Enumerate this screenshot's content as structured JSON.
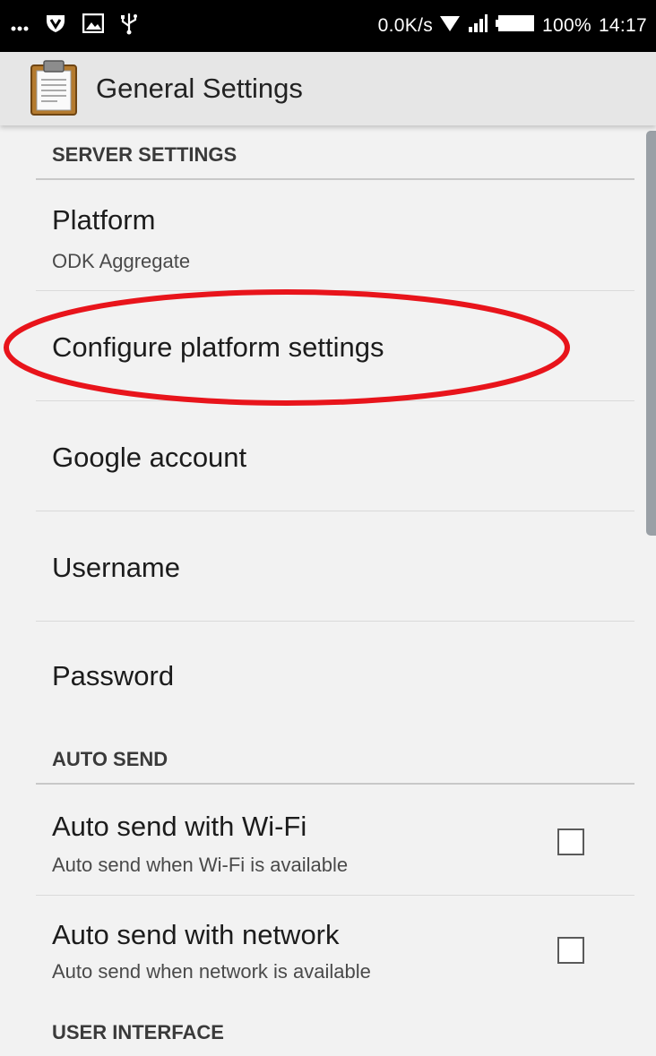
{
  "status_bar": {
    "left_icons": [
      "more-icon",
      "vpn-shield-icon",
      "image-icon",
      "usb-icon"
    ],
    "network_speed": "0.0K/s",
    "battery": "100%",
    "time": "14:17"
  },
  "app_bar": {
    "title": "General Settings",
    "icon": "clipboard-icon"
  },
  "sections": {
    "server": {
      "header": "SERVER SETTINGS",
      "platform": {
        "title": "Platform",
        "summary": "ODK Aggregate"
      },
      "configure": {
        "title": "Configure platform settings"
      },
      "google_account": {
        "title": "Google account"
      },
      "username": {
        "title": "Username"
      },
      "password": {
        "title": "Password"
      }
    },
    "auto_send": {
      "header": "AUTO SEND",
      "wifi": {
        "title": "Auto send with Wi-Fi",
        "summary": "Auto send when Wi-Fi is available",
        "checked": false
      },
      "network": {
        "title": "Auto send with network",
        "summary": "Auto send when network is available",
        "checked": false
      }
    },
    "user_interface": {
      "header": "USER INTERFACE"
    }
  },
  "colors": {
    "status_bar": "#000000",
    "app_bar": "#e6e6e6",
    "background": "#f2f2f2",
    "annotation": "#e8141b"
  }
}
